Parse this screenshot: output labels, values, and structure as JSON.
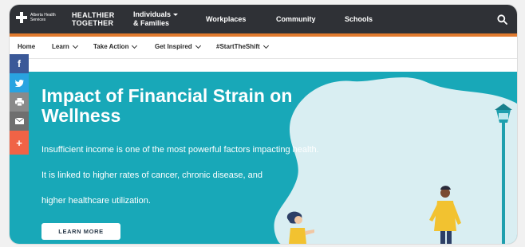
{
  "header": {
    "logo_text": "Alberta Health Services",
    "brand_line1": "HEALTHIER",
    "brand_line2": "TOGETHER",
    "nav": {
      "individuals_line1": "Individuals",
      "individuals_line2": "& Families",
      "workplaces": "Workplaces",
      "community": "Community",
      "schools": "Schools"
    }
  },
  "subnav": {
    "home": "Home",
    "learn": "Learn",
    "take_action": "Take Action",
    "get_inspired": "Get Inspired",
    "start_the_shift": "#StartTheShift"
  },
  "social": {
    "facebook": "f",
    "share": "+"
  },
  "hero": {
    "title": "Impact of Financial Strain on Wellness",
    "line1": "Insufficient income is one of the most powerful factors impacting health.",
    "line2": "It is linked to higher rates of cancer, chronic disease, and",
    "line3": "higher healthcare utilization.",
    "button": "LEARN MORE"
  },
  "colors": {
    "topbar": "#2f3136",
    "accent_orange": "#e07a2e",
    "hero_teal": "#18a8b8",
    "blob": "#d9eef2",
    "facebook": "#3b5998",
    "twitter": "#29a3e0",
    "share": "#f06346"
  },
  "icons": [
    "search-icon",
    "facebook-icon",
    "twitter-icon",
    "print-icon",
    "email-icon",
    "share-plus-icon",
    "chevron-down-icon"
  ]
}
